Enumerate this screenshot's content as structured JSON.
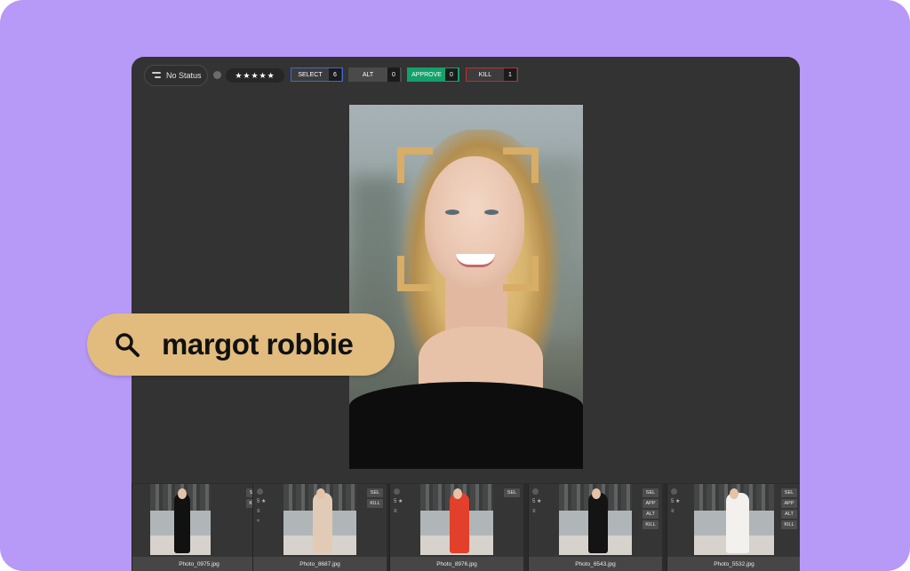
{
  "toolbar": {
    "status_label": "No Status",
    "stars": "★★★★★",
    "select": {
      "label": "SELECT",
      "count": "6"
    },
    "alt": {
      "label": "ALT",
      "count": "0"
    },
    "approve": {
      "label": "APPROVE",
      "count": "0"
    },
    "kill": {
      "label": "KILL",
      "count": "1"
    },
    "colors": {
      "select": "#3f67d6",
      "approve": "#12a16a",
      "kill": "#c92b2b"
    }
  },
  "search": {
    "query": "margot robbie",
    "icon": "search-icon",
    "color": "#e1bc7e"
  },
  "filmstrip": [
    {
      "filename": "Photo_0975.jpg",
      "rating": "",
      "tags": [
        "SEL",
        "KILL"
      ],
      "outfit": "#111111"
    },
    {
      "filename": "Photo_8687.jpg",
      "rating": "5 ★",
      "tags": [
        "SEL",
        "KILL"
      ],
      "outfit": "#e2cbb6"
    },
    {
      "filename": "Photo_8976.jpg",
      "rating": "5 ★",
      "tags": [
        "SEL"
      ],
      "outfit": "#e2402a"
    },
    {
      "filename": "Photo_6543.jpg",
      "rating": "5 ★",
      "tags": [
        "SEL",
        "APP",
        "ALT",
        "KILL"
      ],
      "outfit": "#141414"
    },
    {
      "filename": "Photo_5532.jpg",
      "rating": "5 ★",
      "tags": [
        "SEL",
        "APP",
        "ALT",
        "KILL"
      ],
      "outfit": "#f3f1ee"
    }
  ],
  "colors": {
    "background": "#b799f7",
    "app": "#333333",
    "face_brackets": "#d8ad66"
  }
}
